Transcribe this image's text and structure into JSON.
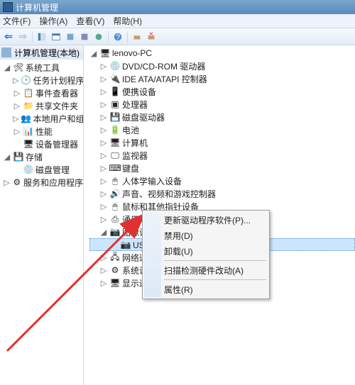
{
  "titlebar": {
    "title": "计算机管理"
  },
  "menubar": {
    "file": "文件(F)",
    "action": "操作(A)",
    "view": "查看(V)",
    "help": "帮助(H)"
  },
  "left": {
    "header": "计算机管理(本地)",
    "sys_tools": "系统工具",
    "task_sched": "任务计划程序",
    "event_viewer": "事件查看器",
    "shared": "共享文件夹",
    "users": "本地用户和组",
    "perf": "性能",
    "devmgr": "设备管理器",
    "storage": "存储",
    "diskmgmt": "磁盘管理",
    "services": "服务和应用程序"
  },
  "right": {
    "root": "lenovo-PC",
    "dvd": "DVD/CD-ROM 驱动器",
    "ide": "IDE ATA/ATAPI 控制器",
    "portable": "便携设备",
    "processors": "处理器",
    "disk_drives": "磁盘驱动器",
    "batteries": "电池",
    "computer": "计算机",
    "monitors": "监视器",
    "keyboards": "键盘",
    "hid": "人体学输入设备",
    "sound": "声音、视频和游戏控制器",
    "mice": "鼠标和其他指针设备",
    "usb_ctrl": "通用串行总线控制器",
    "imaging": "图像设备",
    "usb_video": "USB 视频",
    "network": "网络适配器",
    "system": "系统设备",
    "display": "显示适配器"
  },
  "ctx": {
    "update": "更新驱动程序软件(P)...",
    "disable": "禁用(D)",
    "uninstall": "卸载(U)",
    "scan": "扫描检测硬件改动(A)",
    "properties": "属性(R)"
  }
}
